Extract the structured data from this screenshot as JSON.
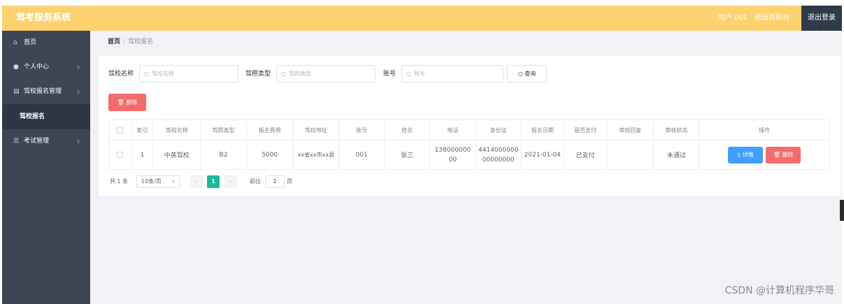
{
  "header": {
    "title": "驾考服务系统",
    "user": "用户 001",
    "front_link": "退出到前台",
    "logout": "退出登录"
  },
  "sidebar": {
    "items": [
      {
        "label": "首页",
        "icon": "home-icon"
      },
      {
        "label": "个人中心",
        "icon": "user-icon"
      },
      {
        "label": "驾校报名管理",
        "icon": "list-icon"
      },
      {
        "label": "驾校报名",
        "icon": ""
      },
      {
        "label": "考试管理",
        "icon": "menu-icon"
      }
    ]
  },
  "breadcrumb": {
    "home": "首页",
    "separator": "/",
    "current": "驾校报名"
  },
  "search": {
    "school_label": "驾校名称",
    "school_placeholder": "驾校名称",
    "license_label": "驾照类型",
    "license_placeholder": "驾照类型",
    "account_label": "账号",
    "account_placeholder": "账号",
    "query_button": "查询"
  },
  "actions": {
    "delete_button": "删除"
  },
  "table": {
    "headers": [
      "索引",
      "驾校名称",
      "驾照类型",
      "报名费用",
      "驾校地址",
      "账号",
      "姓名",
      "电话",
      "身份证",
      "报名日期",
      "是否支付",
      "审核回复",
      "审核状态",
      "操作"
    ],
    "rows": [
      {
        "index": "1",
        "school": "中英驾校",
        "license": "B2",
        "fee": "5000",
        "address": "xx省xx市xx县",
        "account": "001",
        "name": "张三",
        "phone": "13800000000",
        "id_card": "441400000000000000",
        "date": "2021-01-04",
        "paid": "已支付",
        "reply": "",
        "status": "未通过",
        "detail_button": "详情",
        "delete_button": "删除"
      }
    ]
  },
  "pagination": {
    "total": "共 1 条",
    "page_size": "10条/页",
    "current_page": "1",
    "goto_label": "前往",
    "goto_value": "1",
    "page_unit": "页"
  },
  "watermark": "CSDN @计算机程序华哥",
  "colors": {
    "header_bg": "#fcd271",
    "sidebar_bg": "#3e4656",
    "primary": "#409eff",
    "danger": "#f56c6c",
    "page_active": "#18bc9c"
  }
}
